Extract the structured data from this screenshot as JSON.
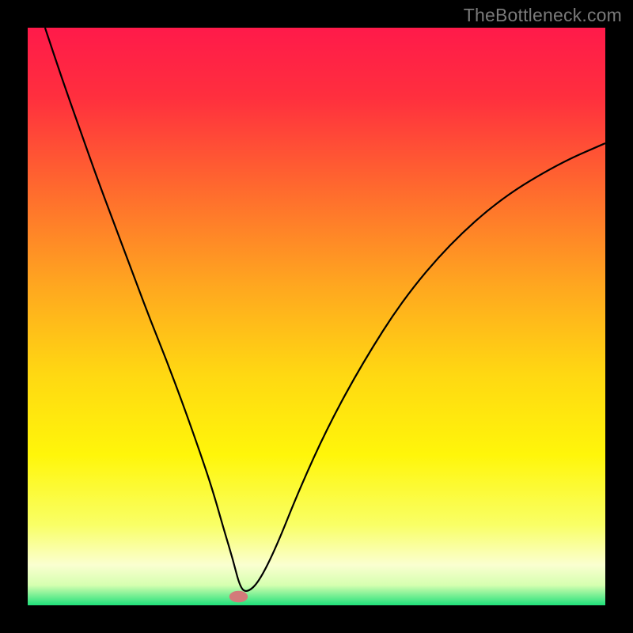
{
  "watermark": "TheBottleneck.com",
  "chart_data": {
    "type": "line",
    "title": "",
    "xlabel": "",
    "ylabel": "",
    "xlim": [
      0,
      100
    ],
    "ylim": [
      0,
      100
    ],
    "grid": false,
    "legend": false,
    "background_gradient": {
      "stops": [
        {
          "offset": 0.0,
          "color": "#ff1a4a"
        },
        {
          "offset": 0.12,
          "color": "#ff2f3e"
        },
        {
          "offset": 0.28,
          "color": "#ff6a2e"
        },
        {
          "offset": 0.45,
          "color": "#ffa81f"
        },
        {
          "offset": 0.6,
          "color": "#ffd812"
        },
        {
          "offset": 0.74,
          "color": "#fff60a"
        },
        {
          "offset": 0.86,
          "color": "#f9ff65"
        },
        {
          "offset": 0.93,
          "color": "#faffd0"
        },
        {
          "offset": 0.965,
          "color": "#d6ffb0"
        },
        {
          "offset": 1.0,
          "color": "#1fe07a"
        }
      ]
    },
    "marker": {
      "x": 36.5,
      "y": 1.5,
      "rx": 1.6,
      "ry": 1.0,
      "color": "#d37a7a"
    },
    "series": [
      {
        "name": "bottleneck-curve",
        "color": "#000000",
        "width": 2.2,
        "x": [
          3.0,
          6,
          9,
          12,
          15,
          18,
          21,
          24,
          27,
          30,
          32,
          34,
          35.5,
          36.8,
          38,
          40,
          43,
          47,
          52,
          58,
          65,
          73,
          82,
          92,
          100
        ],
        "y": [
          100,
          91,
          82.5,
          74,
          66,
          58,
          50,
          42.5,
          34.5,
          26,
          20,
          13,
          8,
          3,
          2.2,
          4,
          10,
          20,
          31,
          42,
          53,
          62.5,
          70.5,
          76.5,
          80
        ]
      }
    ]
  }
}
